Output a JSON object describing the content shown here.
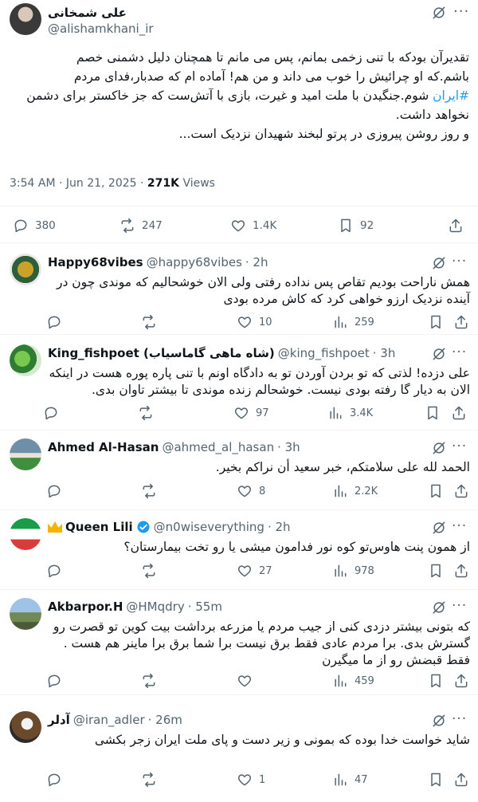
{
  "main": {
    "author": {
      "name": "علی شمخانی",
      "handle": "@alishamkhani_ir"
    },
    "text_lines": [
      "تقدیرآن بودکه با تنی زخمی بمانم، پس می مانم تا همچنان دلیل دشمنی خصم",
      "باشم.که او چرائیش را خوب می داند و من هم! آماده ام که صدبار،فدای مردم",
      "شوم.جنگیدن با ملت امید و غیرت، بازی با آتش‌ست که جز خاکستر برای دشمن",
      "نخواهد داشت.",
      "و روز روشن پیروزی در پرتو لبخند شهیدان نزدیک است..."
    ],
    "hashtag": "#ایران",
    "timestamp": "3:54 AM · Jun 21, 2025 · ",
    "views_count": "271K",
    "views_label": " Views",
    "stats": {
      "replies": "380",
      "reposts": "247",
      "likes": "1.4K",
      "bookmarks": "92"
    }
  },
  "replies": [
    {
      "name": "Happy68vibes",
      "handle": "@happy68vibes",
      "time": "· 2h",
      "text": "همش ناراحت بودیم تقاص پس نداده رفتی ولی الان خوشحالیم که موندی چون در آینده نزدیک ارزو خواهی کرد که کاش مرده بودی",
      "replies": "",
      "reposts": "",
      "likes": "10",
      "views": "259"
    },
    {
      "name": "King_fishpoet (شاه ماهی گاماسیاب)",
      "handle": "@king_fishpoet",
      "time": "· 3h",
      "text": "علی دزده! لذتی که تو بردن آوردن تو به دادگاه اونم با تنی پاره پوره هست در اینکه الان به دیار گا رفته بودی نیست. خوشحالم زنده موندی تا بیشتر تاوان بدی.",
      "replies": "",
      "reposts": "",
      "likes": "97",
      "views": "3.4K"
    },
    {
      "name": "Ahmed Al-Hasan",
      "handle": "@ahmed_al_hasan",
      "time": "· 3h",
      "text": "الحمد لله على سلامتكم، خبر سعيد أن نراكم بخير.",
      "replies": "",
      "reposts": "",
      "likes": "8",
      "views": "2.2K"
    },
    {
      "name": "Queen Lili",
      "handle": "@n0wiseverything",
      "time": "· 2h",
      "text": "از همون پنت هاوس‌تو کوه نور فدامون میشی یا رو تخت بیمارستان؟",
      "replies": "",
      "reposts": "",
      "likes": "27",
      "views": "978"
    },
    {
      "name": "Akbarpor.H",
      "handle": "@HMqdry",
      "time": "· 55m",
      "text": "که بتونی بیشتر دزدی کنی از جیب مردم یا مزرعه برداشت بیت کوین تو قصرت رو گسترش بدی. برا مردم عادی فقط برق نیست برا شما برق برا ماینر هم هست . فقط قبضش رو از ما میگیرن",
      "replies": "",
      "reposts": "",
      "likes": "",
      "views": "459"
    },
    {
      "name": "آدلر",
      "handle": "@iran_adler",
      "time": "· 26m",
      "text": "شاید خواست خدا بوده که بمونی و زیر دست و پای ملت ایران زجر بکشی",
      "replies": "",
      "reposts": "",
      "likes": "1",
      "views": "47"
    }
  ],
  "icons": {
    "reply": "reply-icon",
    "repost": "repost-icon",
    "like": "like-icon",
    "views": "views-icon",
    "bookmark": "bookmark-icon",
    "share": "share-icon",
    "grok": "grok-icon",
    "more": "more-icon"
  },
  "colors": {
    "accent": "#1d9bf0",
    "text": "#0f1419",
    "muted": "#536471",
    "divider": "#eff3f4"
  }
}
